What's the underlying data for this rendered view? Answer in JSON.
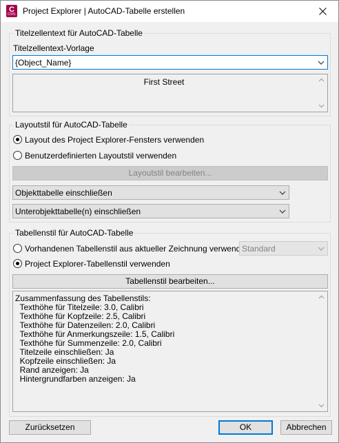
{
  "window": {
    "title": "Project Explorer | AutoCAD-Tabelle erstellen",
    "icon_letter": "C",
    "icon_sub": "CIVIL"
  },
  "title_group": {
    "legend": "Titelzellentext für AutoCAD-Tabelle",
    "template_label": "Titelzellentext-Vorlage",
    "template_value": "{Object_Name}",
    "preview": "First Street"
  },
  "layout_group": {
    "legend": "Layoutstil für AutoCAD-Tabelle",
    "option1": "Layout des Project Explorer-Fensters verwenden",
    "option2": "Benutzerdefinierten Layoutstil verwenden",
    "edit_button": "Layoutstil bearbeiten...",
    "object_table": "Objekttabelle einschließen",
    "subobject_table": "Unterobjekttabelle(n) einschließen"
  },
  "style_group": {
    "legend": "Tabellenstil für AutoCAD-Tabelle",
    "option1": "Vorhandenen Tabellenstil aus aktueller Zeichnung verwenden:",
    "option1_value": "Standard",
    "option2": "Project Explorer-Tabellenstil verwenden",
    "edit_button": "Tabellenstil bearbeiten..."
  },
  "summary": {
    "lines": [
      "Zusammenfassung des Tabellenstils:",
      "  Texthöhe für Titelzeile: 3.0, Calibri",
      "  Texthöhe für Kopfzeile: 2.5, Calibri",
      "  Texthöhe für Datenzeilen: 2.0, Calibri",
      "  Texthöhe für Anmerkungszeile: 1.5, Calibri",
      "  Texthöhe für Summenzeile: 2.0, Calibri",
      "  Titelzeile einschließen: Ja",
      "  Kopfzeile einschließen: Ja",
      "  Rand anzeigen: Ja",
      "  Hintergrundfarben anzeigen: Ja"
    ]
  },
  "footer": {
    "reset": "Zurücksetzen",
    "ok": "OK",
    "cancel": "Abbrechen"
  }
}
